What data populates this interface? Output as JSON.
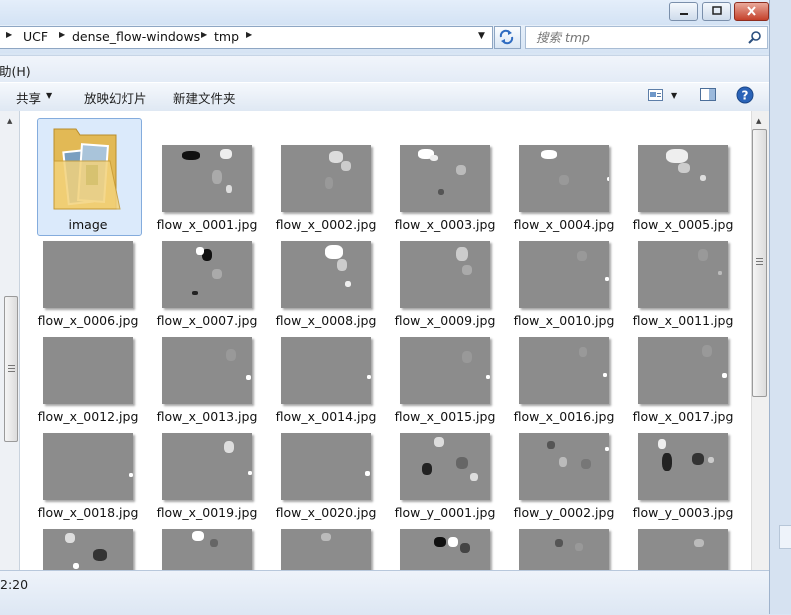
{
  "window": {
    "controls": {
      "minimize": "minimize",
      "maximize": "maximize",
      "close": "close"
    }
  },
  "address": {
    "crumbs": [
      "UCF",
      "dense_flow-windows",
      "tmp"
    ]
  },
  "search": {
    "placeholder": "搜索 tmp"
  },
  "menubar": {
    "help": "助(H)"
  },
  "toolbar": {
    "share": "共享",
    "slideshow": "放映幻灯片",
    "new_folder": "新建文件夹"
  },
  "files": [
    {
      "name": "image",
      "type": "folder",
      "selected": true
    },
    {
      "name": "flow_x_0001.jpg",
      "type": "image"
    },
    {
      "name": "flow_x_0002.jpg",
      "type": "image"
    },
    {
      "name": "flow_x_0003.jpg",
      "type": "image"
    },
    {
      "name": "flow_x_0004.jpg",
      "type": "image"
    },
    {
      "name": "flow_x_0005.jpg",
      "type": "image"
    },
    {
      "name": "flow_x_0006.jpg",
      "type": "image"
    },
    {
      "name": "flow_x_0007.jpg",
      "type": "image"
    },
    {
      "name": "flow_x_0008.jpg",
      "type": "image"
    },
    {
      "name": "flow_x_0009.jpg",
      "type": "image"
    },
    {
      "name": "flow_x_0010.jpg",
      "type": "image"
    },
    {
      "name": "flow_x_0011.jpg",
      "type": "image"
    },
    {
      "name": "flow_x_0012.jpg",
      "type": "image"
    },
    {
      "name": "flow_x_0013.jpg",
      "type": "image"
    },
    {
      "name": "flow_x_0014.jpg",
      "type": "image"
    },
    {
      "name": "flow_x_0015.jpg",
      "type": "image"
    },
    {
      "name": "flow_x_0016.jpg",
      "type": "image"
    },
    {
      "name": "flow_x_0017.jpg",
      "type": "image"
    },
    {
      "name": "flow_x_0018.jpg",
      "type": "image"
    },
    {
      "name": "flow_x_0019.jpg",
      "type": "image"
    },
    {
      "name": "flow_x_0020.jpg",
      "type": "image"
    },
    {
      "name": "flow_y_0001.jpg",
      "type": "image"
    },
    {
      "name": "flow_y_0002.jpg",
      "type": "image"
    },
    {
      "name": "flow_y_0003.jpg",
      "type": "image"
    },
    {
      "name": "",
      "type": "image"
    },
    {
      "name": "",
      "type": "image"
    },
    {
      "name": "",
      "type": "image"
    },
    {
      "name": "",
      "type": "image"
    },
    {
      "name": "",
      "type": "image"
    },
    {
      "name": "",
      "type": "image"
    }
  ],
  "status": {
    "time_fragment": "2:20"
  },
  "colors": {
    "accent": "#3c6fb0",
    "selection": "#dbeafb",
    "thumb_gray": "#8c8c8c"
  }
}
